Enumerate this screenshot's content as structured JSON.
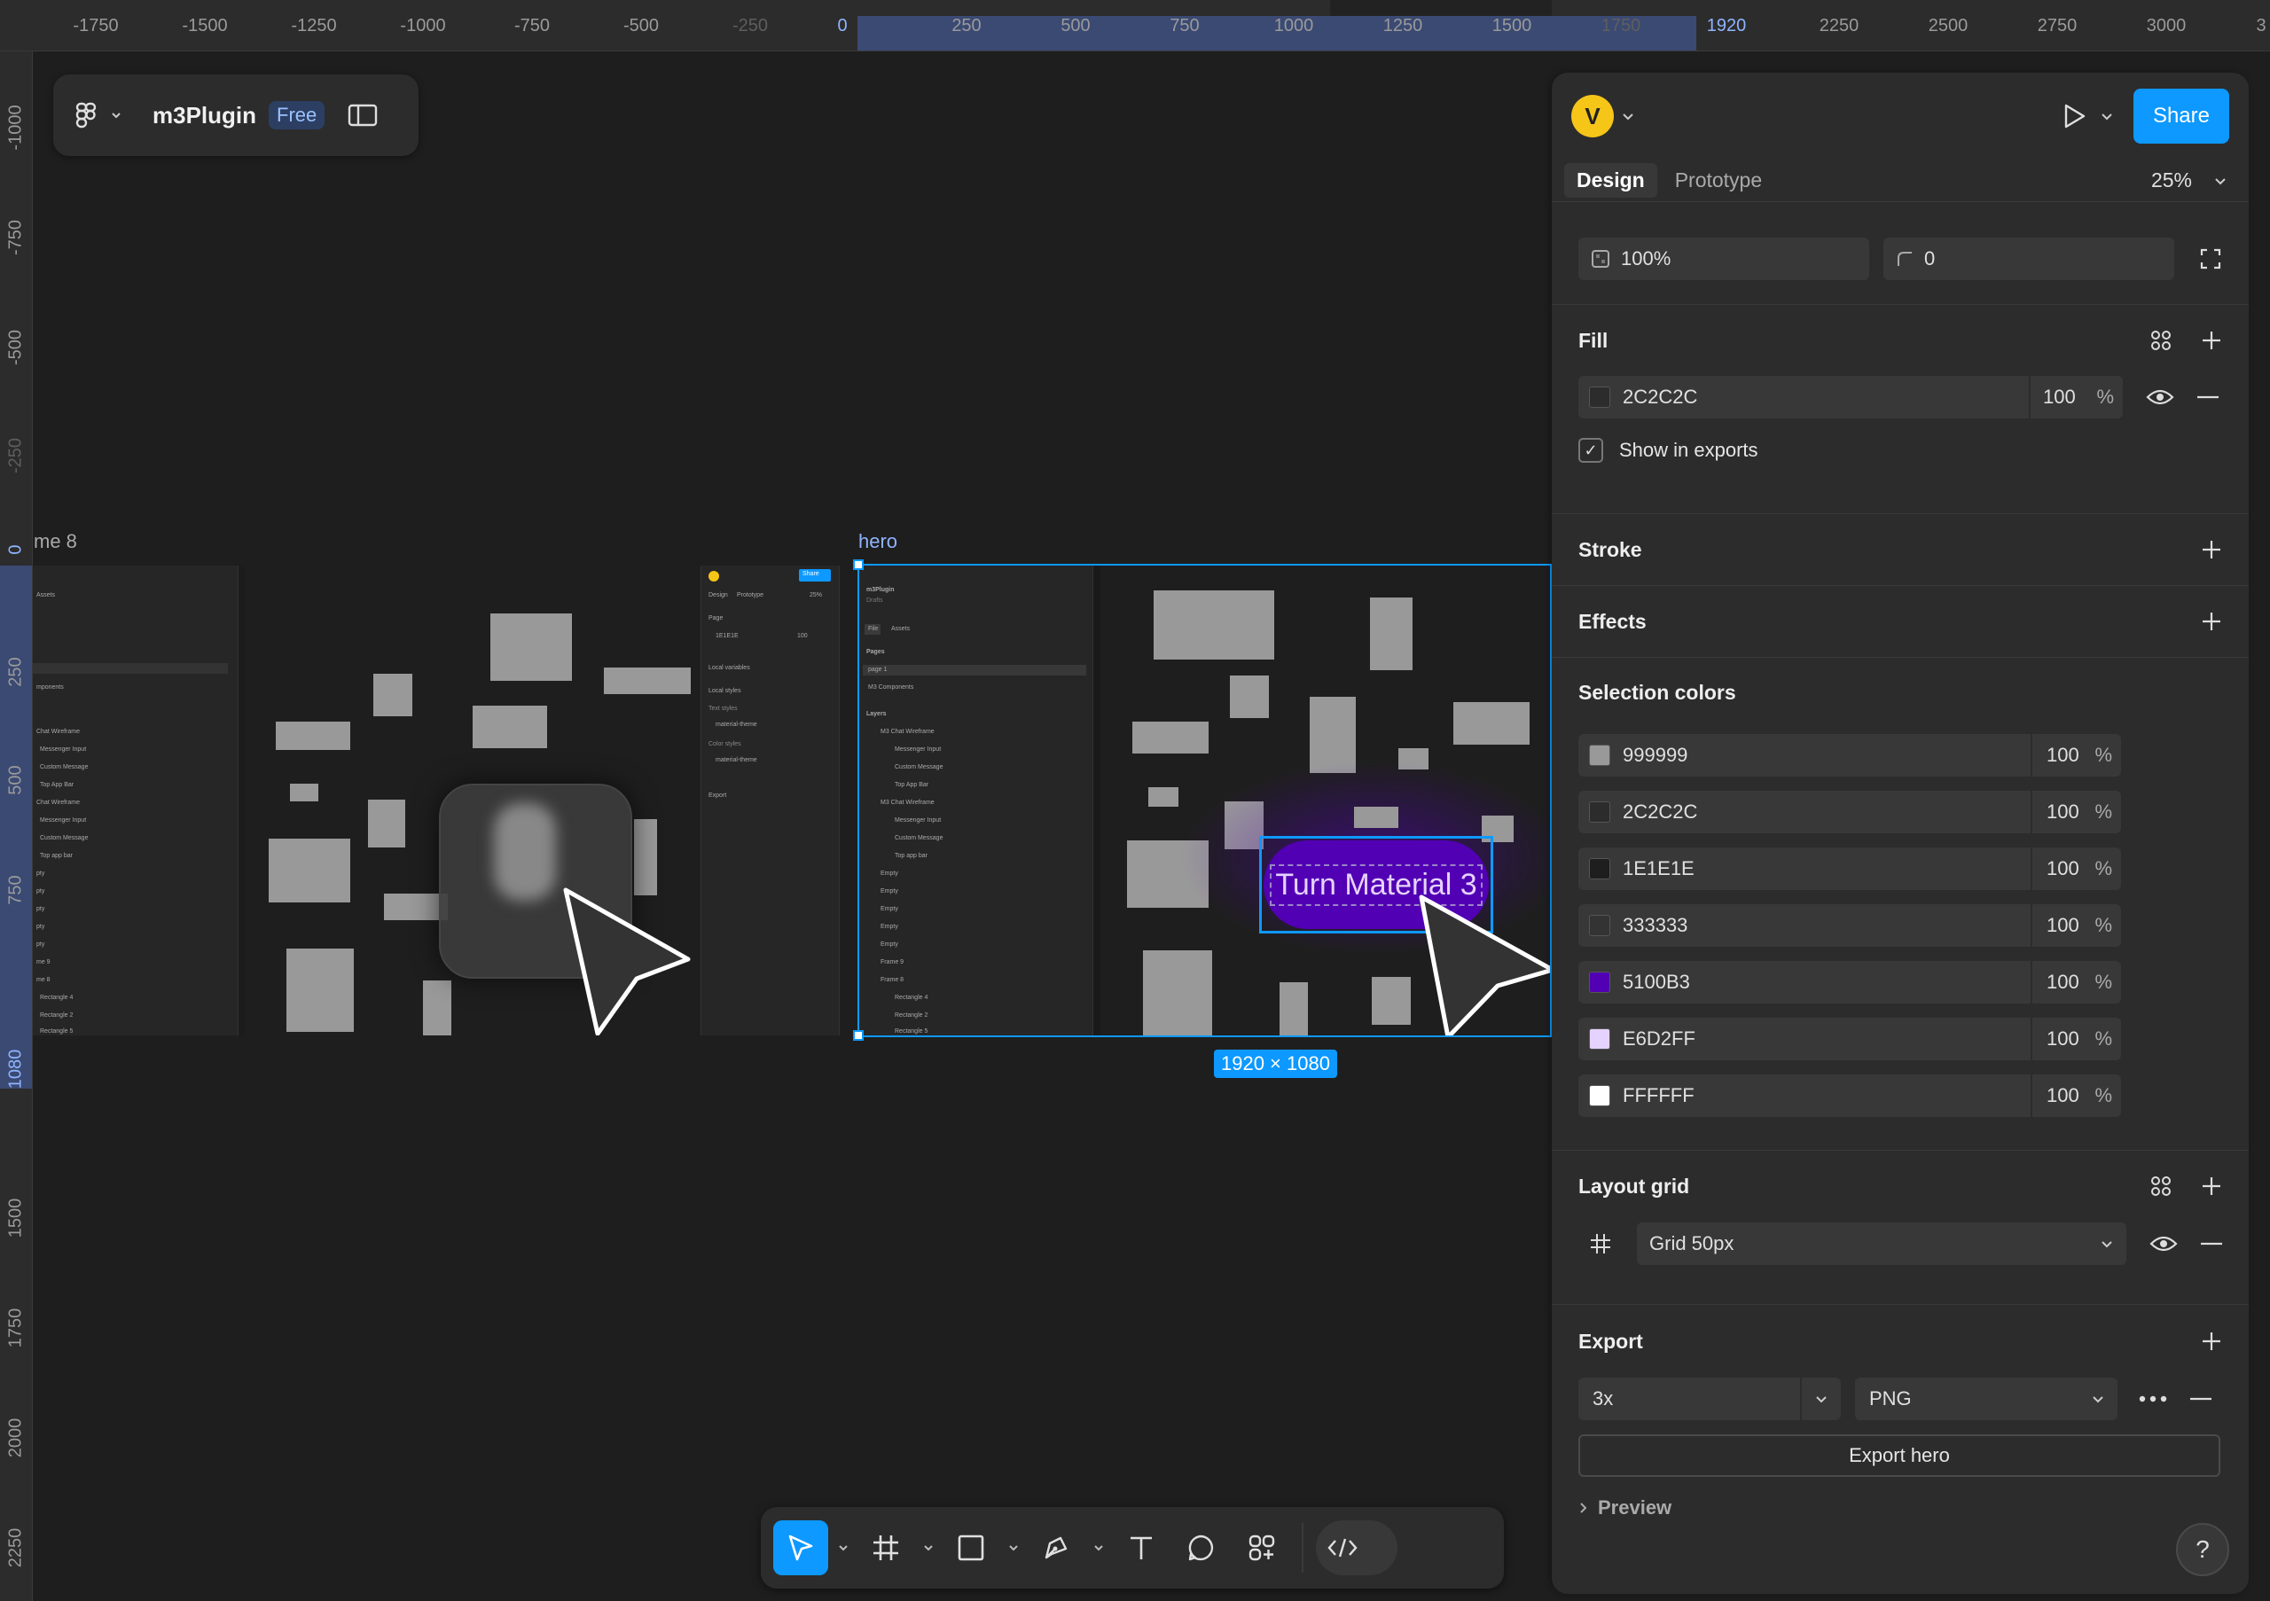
{
  "ruler": {
    "top_ticks": [
      "-1750",
      "-1500",
      "-1250",
      "-1000",
      "-750",
      "-500",
      "-250",
      "0",
      "250",
      "500",
      "750",
      "1000",
      "1250",
      "1500",
      "1750",
      "1920",
      "2250",
      "2500",
      "2750",
      "3000",
      "3"
    ],
    "left_ticks": [
      "-1000",
      "-750",
      "-500",
      "-250",
      "0",
      "250",
      "500",
      "750",
      "1080",
      "1500",
      "1750",
      "2000",
      "2250"
    ]
  },
  "file": {
    "name": "m3Plugin",
    "plan_badge": "Free"
  },
  "canvas": {
    "frame8_label": "me 8",
    "hero_label": "hero",
    "hero_button_text": "Turn Material 3",
    "size_badge": "1920 × 1080",
    "mini": {
      "file_title": "m3Plugin",
      "drafts": "Drafts",
      "file_tab": "File",
      "assets_tab": "Assets",
      "pages": "Pages",
      "page_1": "page 1",
      "m3_components": "M3 Components",
      "layers": "Layers",
      "layer_items": [
        "M3 Chat Wireframe",
        "Messenger Input",
        "Custom Message",
        "Top App Bar",
        "M3 Chat Wireframe",
        "Messenger Input",
        "Custom Message",
        "Top app bar",
        "Empty",
        "Empty",
        "Empty",
        "Empty",
        "Empty",
        "Frame 9",
        "Frame 8",
        "Rectangle 4",
        "Rectangle 2",
        "Rectangle 5"
      ],
      "left_items": [
        "Assets",
        "mponents",
        "Chat Wireframe",
        "Messenger Input",
        "Custom Message",
        "Top App Bar",
        "Chat Wireframe",
        "Messenger Input",
        "Custom Message",
        "Top app bar",
        "pty",
        "pty",
        "pty",
        "pty",
        "pty",
        "me 9",
        "me 8",
        "Rectangle 4",
        "Rectangle 2",
        "Rectangle 5"
      ],
      "design_tab": "Design",
      "prototype_tab": "Prototype",
      "zoom": "25%",
      "share": "Share",
      "page": "Page",
      "page_color": "1E1E1E",
      "page_opacity": "100",
      "local_variables": "Local variables",
      "local_styles": "Local styles",
      "text_styles": "Text styles",
      "material_theme": "material-theme",
      "color_styles": "Color styles",
      "export": "Export"
    }
  },
  "panel": {
    "avatar_initial": "V",
    "share_label": "Share",
    "tabs": [
      "Design",
      "Prototype"
    ],
    "zoom": "25%",
    "layer": {
      "opacity": "100%",
      "radius": "0"
    },
    "fill": {
      "title": "Fill",
      "hex": "2C2C2C",
      "opacity": "100",
      "pct": "%",
      "show_in_exports": "Show in exports"
    },
    "stroke": {
      "title": "Stroke"
    },
    "effects": {
      "title": "Effects"
    },
    "selection_colors": {
      "title": "Selection colors",
      "items": [
        {
          "hex": "999999",
          "opacity": "100",
          "pct": "%",
          "color": "#999999"
        },
        {
          "hex": "2C2C2C",
          "opacity": "100",
          "pct": "%",
          "color": "#2C2C2C"
        },
        {
          "hex": "1E1E1E",
          "opacity": "100",
          "pct": "%",
          "color": "#1E1E1E"
        },
        {
          "hex": "333333",
          "opacity": "100",
          "pct": "%",
          "color": "#333333"
        },
        {
          "hex": "5100B3",
          "opacity": "100",
          "pct": "%",
          "color": "#5100B3"
        },
        {
          "hex": "E6D2FF",
          "opacity": "100",
          "pct": "%",
          "color": "#E6D2FF"
        },
        {
          "hex": "FFFFFF",
          "opacity": "100",
          "pct": "%",
          "color": "#FFFFFF"
        }
      ]
    },
    "layout_grid": {
      "title": "Layout grid",
      "value": "Grid 50px"
    },
    "export": {
      "title": "Export",
      "scale": "3x",
      "format": "PNG",
      "button": "Export hero",
      "preview": "Preview"
    },
    "help": "?"
  },
  "colors": {
    "accent": "#0d99ff",
    "purple": "#5100B3",
    "lavender": "#E6D2FF",
    "avatar": "#f5c518"
  },
  "toolbar": {
    "tools": [
      "move-tool",
      "frame-tool",
      "rectangle-tool",
      "pen-tool",
      "text-tool",
      "comment-tool",
      "components-tool",
      "dev-mode-toggle"
    ]
  }
}
